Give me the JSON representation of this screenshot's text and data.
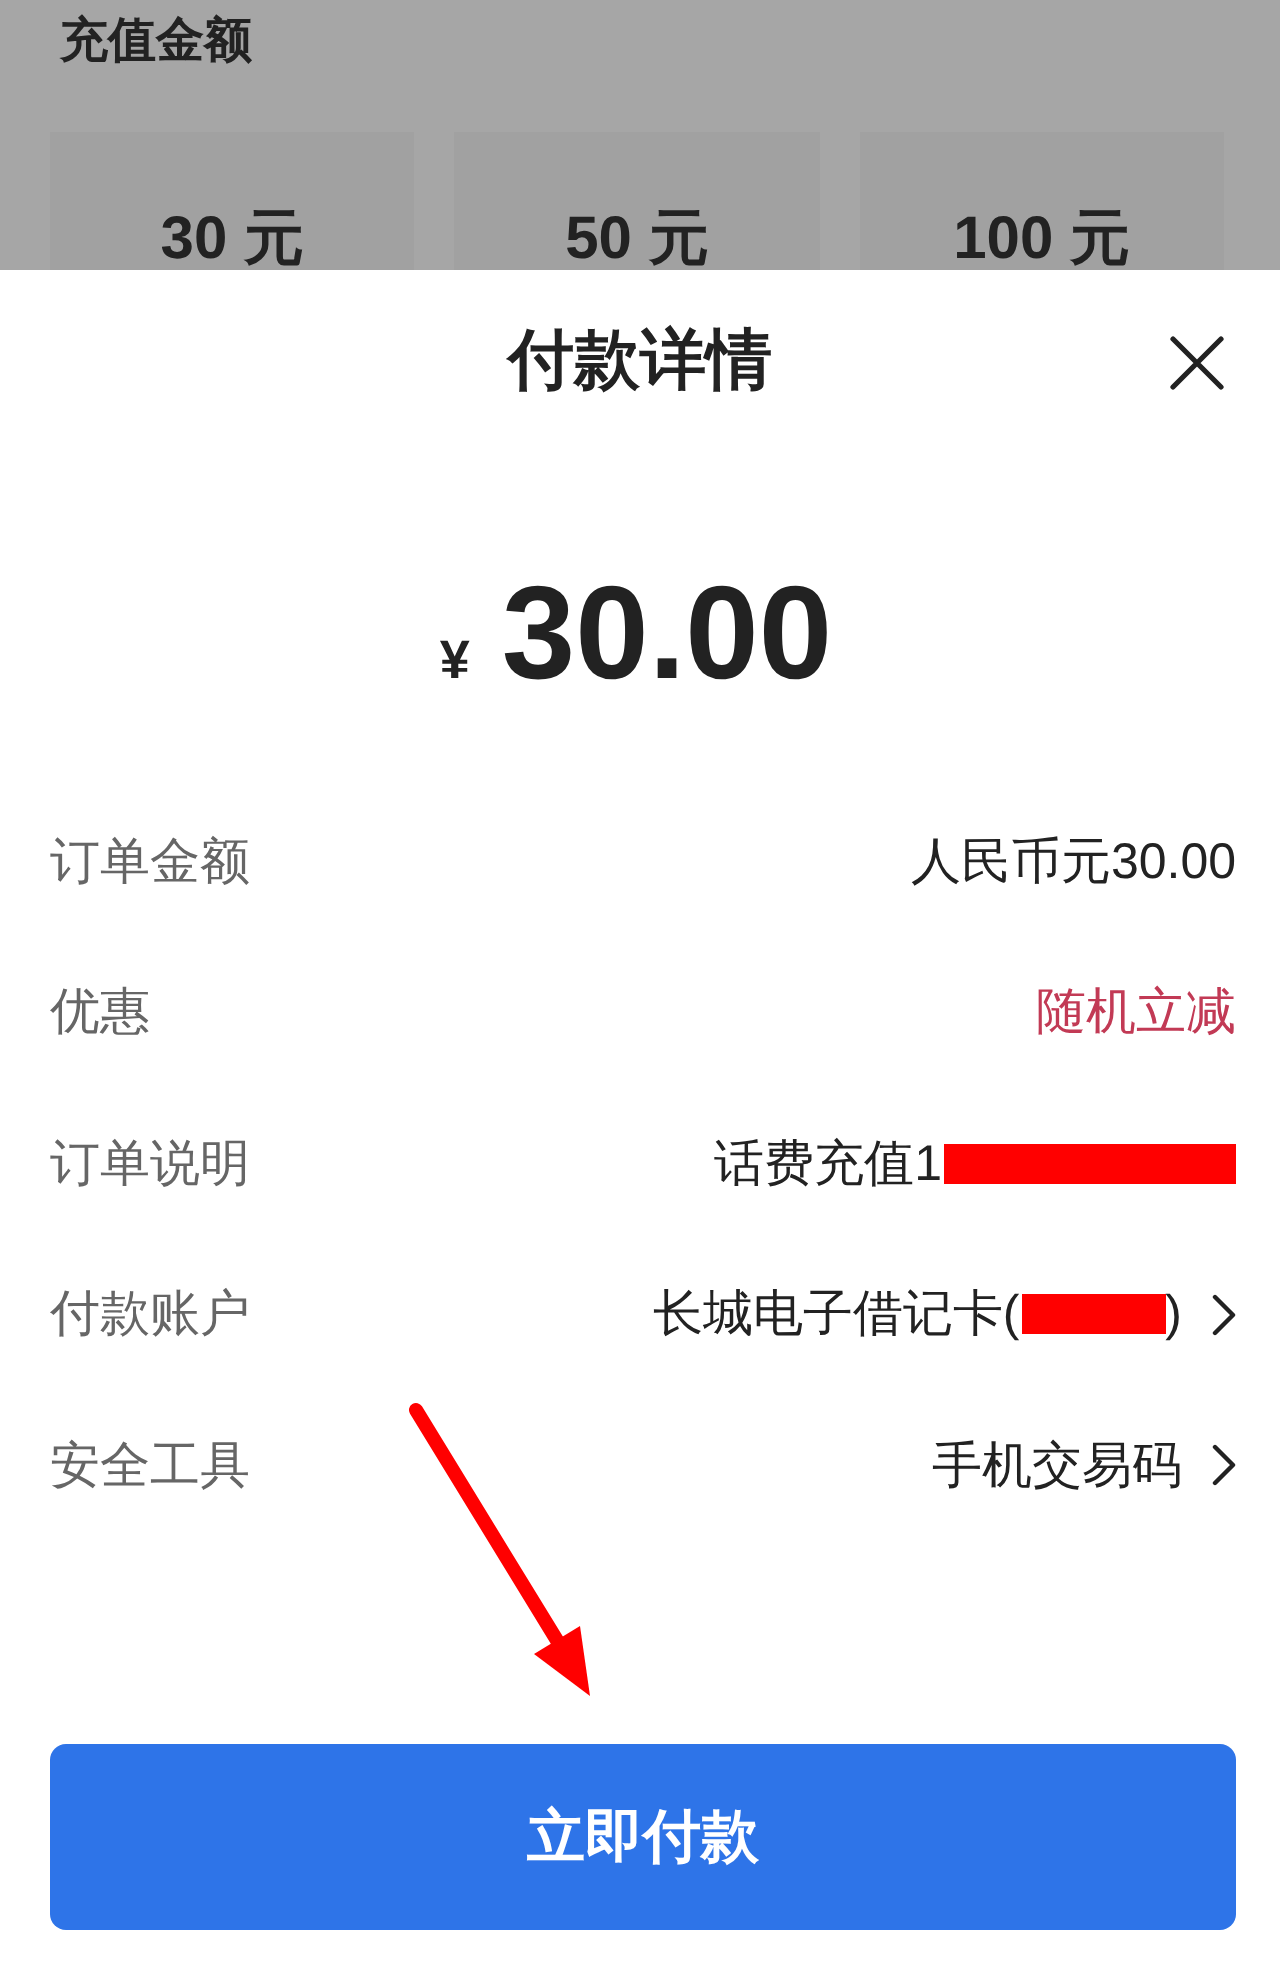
{
  "background": {
    "title": "充值金额",
    "amounts": [
      "30 元",
      "50 元",
      "100 元"
    ]
  },
  "sheet": {
    "title": "付款详情",
    "currency": "¥",
    "amount": "30.00",
    "rows": [
      {
        "label": "订单金额",
        "value": "人民币元30.00",
        "kind": "plain",
        "redacted": false
      },
      {
        "label": "优惠",
        "value": "随机立减",
        "kind": "promo",
        "redacted": false
      },
      {
        "label": "订单说明",
        "value": "话费充值1",
        "kind": "plain",
        "redacted": true
      },
      {
        "label": "付款账户",
        "value": "长城电子借记卡(",
        "value_end": ")",
        "kind": "link",
        "redacted": true
      },
      {
        "label": "安全工具",
        "value": "手机交易码",
        "kind": "link",
        "redacted": false
      }
    ],
    "pay_button": "立即付款"
  },
  "annotations": [
    {
      "kind": "arrow"
    }
  ]
}
